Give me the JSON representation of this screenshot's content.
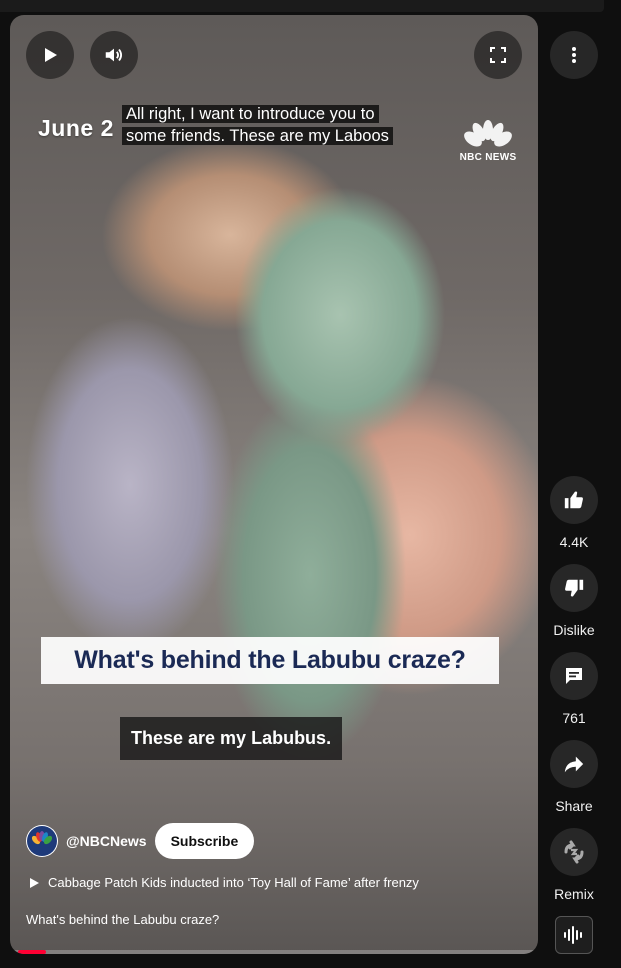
{
  "video": {
    "date_overlay": "June 2",
    "caption_top": [
      "All right, I want to introduce you to",
      "some friends. These are my Laboos"
    ],
    "logo_text": "NBC NEWS",
    "headline": "What's behind the Labubu craze?",
    "caption_bottom": "These are my Labubus.",
    "channel_handle": "@NBCNews",
    "subscribe_label": "Subscribe",
    "related_text": "Cabbage Patch Kids inducted into ‘Toy Hall of Fame’ after frenzy",
    "title": "What's behind the Labubu craze?",
    "progress": 0.053
  },
  "controls": {
    "play_icon": "play-icon",
    "volume_icon": "volume-icon",
    "fullscreen_icon": "fullscreen-icon"
  },
  "actions": {
    "like_count": "4.4K",
    "dislike_label": "Dislike",
    "comments_count": "761",
    "share_label": "Share",
    "remix_label": "Remix"
  },
  "colors": {
    "progress": "#ff0033",
    "headline_text": "#1b2a55"
  }
}
